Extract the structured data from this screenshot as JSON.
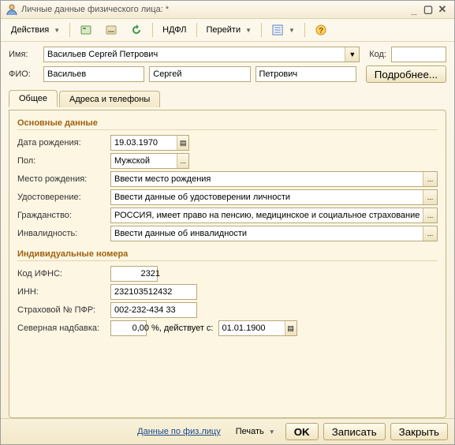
{
  "window": {
    "title": "Личные данные физического лица: *",
    "minimize": "_",
    "maximize": "▢",
    "close": "✕"
  },
  "toolbar": {
    "actions": "Действия",
    "ndfl": "НДФЛ",
    "goto": "Перейти"
  },
  "header": {
    "name_label": "Имя:",
    "name_value": "Васильев Сергей Петрович",
    "code_label": "Код:",
    "code_value": "",
    "fio_label": "ФИО:",
    "last": "Васильев",
    "first": "Сергей",
    "middle": "Петрович",
    "more_btn": "Подробнее..."
  },
  "tabs": {
    "general": "Общее",
    "addresses": "Адреса и телефоны"
  },
  "main": {
    "section1": "Основные данные",
    "birth_label": "Дата рождения:",
    "birth_value": "19.03.1970",
    "sex_label": "Пол:",
    "sex_value": "Мужской",
    "birthplace_label": "Место рождения:",
    "birthplace_value": "Ввести место рождения",
    "id_label": "Удостоверение:",
    "id_value": "Ввести данные об удостоверении личности",
    "citizen_label": "Гражданство:",
    "citizen_value": "РОССИЯ, имеет право на пенсию, медицинское и социальное страхование",
    "disability_label": "Инвалидность:",
    "disability_value": "Ввести данные об инвалидности",
    "section2": "Индивидуальные номера",
    "ifns_label": "Код ИФНС:",
    "ifns_value": "2321",
    "inn_label": "ИНН:",
    "inn_value": "232103512432",
    "pfr_label": "Страховой № ПФР:",
    "pfr_value": "002-232-434 33",
    "north_label": "Северная надбавка:",
    "north_value": "0,00",
    "north_unit": "%,  действует с:",
    "north_date": "01.01.1900"
  },
  "footer": {
    "phys": "Данные по физ.лицу",
    "print": "Печать",
    "ok": "OK",
    "save": "Записать",
    "close": "Закрыть"
  },
  "glyph": {
    "dots": "...",
    "cal": "▤",
    "drop": "▼"
  }
}
